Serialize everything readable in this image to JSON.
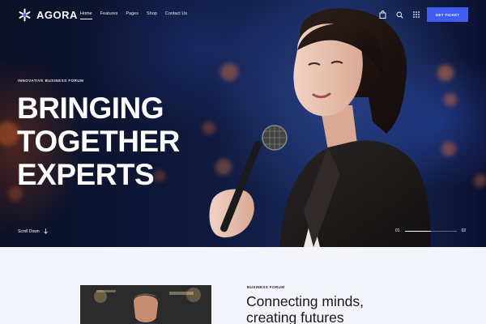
{
  "brand": {
    "name": "AGORA"
  },
  "nav": {
    "items": [
      {
        "label": "Home",
        "active": true
      },
      {
        "label": "Features",
        "active": false
      },
      {
        "label": "Pages",
        "active": false
      },
      {
        "label": "Shop",
        "active": false
      },
      {
        "label": "Contact Us",
        "active": false
      }
    ],
    "icons": [
      "bag-icon",
      "search-icon",
      "grid-menu-icon"
    ],
    "cta_label": "Get Ticket"
  },
  "hero": {
    "eyebrow": "Innovative Business Forum",
    "headline": [
      "BRINGING",
      "TOGETHER",
      "EXPERTS"
    ],
    "scroll_label": "Scroll Down",
    "slider": {
      "current": "01",
      "total": "02",
      "progress": 0.5
    }
  },
  "about": {
    "eyebrow": "Business Forum",
    "title": [
      "Connecting minds,",
      "creating futures"
    ]
  },
  "colors": {
    "accent": "#3f5cf4",
    "hero_bg": "#101a3e",
    "section_bg": "#f4f5fb"
  }
}
